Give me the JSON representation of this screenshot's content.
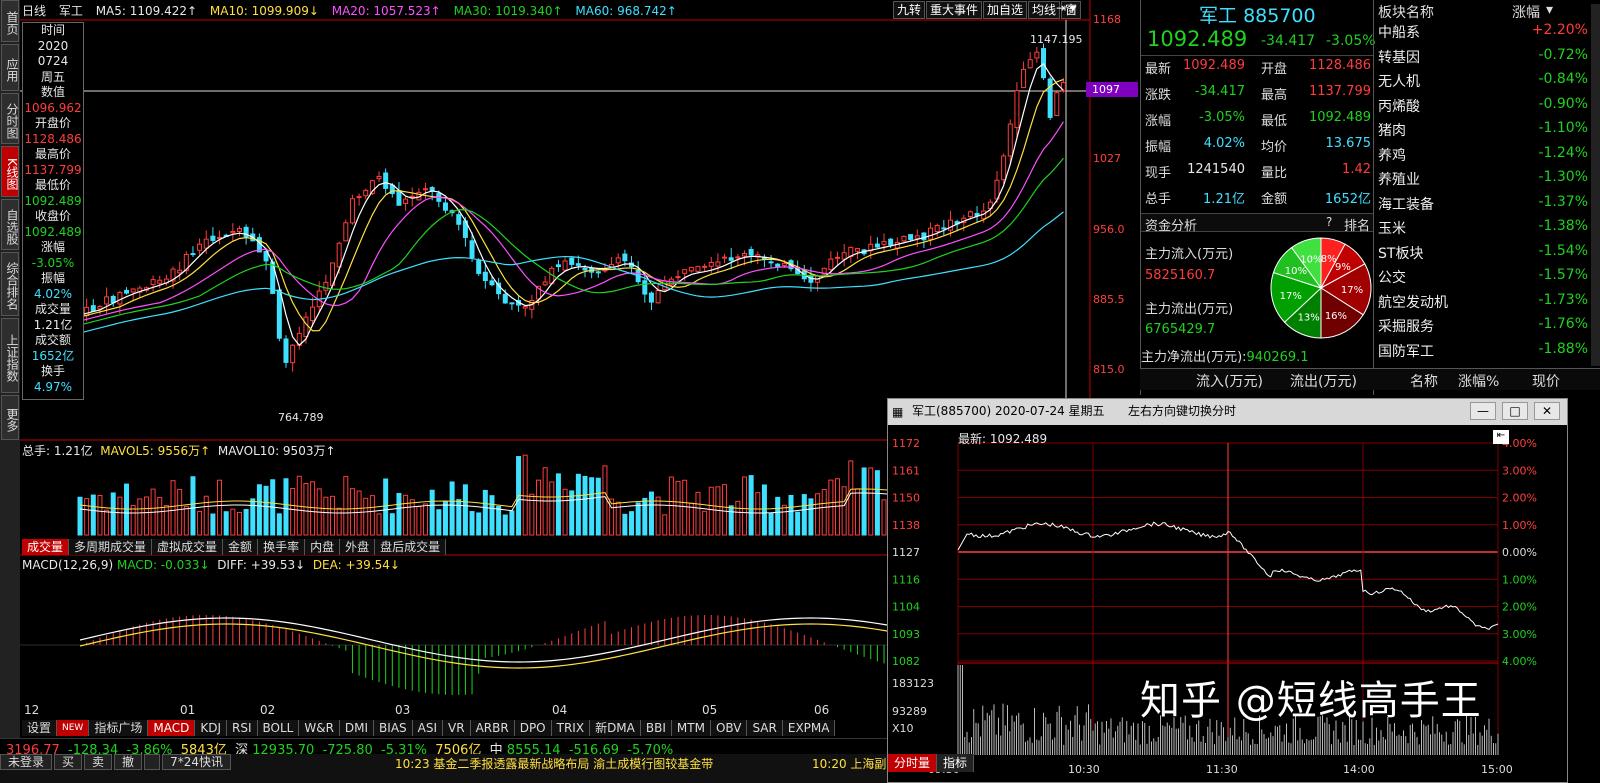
{
  "left_tabs": [
    "首页",
    "应用",
    "分时图",
    "K线图",
    "自选股",
    "综合排名",
    "上证指数",
    "更多"
  ],
  "kline_header": {
    "period": "日线",
    "name": "军工",
    "ma5": "MA5: 1109.422↑",
    "ma10": "MA10: 1099.909↓",
    "ma20": "MA20: 1057.523↑",
    "ma30": "MA30: 1019.340↑",
    "ma60": "MA60: 968.742↑"
  },
  "top_buttons": [
    "九转",
    "重大事件",
    "加自选",
    "均线",
    "窗"
  ],
  "info_box": [
    {
      "t": "时间",
      "c": "wht"
    },
    {
      "t": "2020",
      "c": "wht"
    },
    {
      "t": "0724",
      "c": "wht"
    },
    {
      "t": "周五",
      "c": "wht"
    },
    {
      "t": "数值",
      "c": "wht"
    },
    {
      "t": "1096.962",
      "c": "red"
    },
    {
      "t": "开盘价",
      "c": "wht"
    },
    {
      "t": "1128.486",
      "c": "red"
    },
    {
      "t": "最高价",
      "c": "wht"
    },
    {
      "t": "1137.799",
      "c": "red"
    },
    {
      "t": "最低价",
      "c": "wht"
    },
    {
      "t": "1092.489",
      "c": "grn"
    },
    {
      "t": "收盘价",
      "c": "wht"
    },
    {
      "t": "1092.489",
      "c": "grn"
    },
    {
      "t": "涨幅",
      "c": "wht"
    },
    {
      "t": "-3.05%",
      "c": "grn"
    },
    {
      "t": "振幅",
      "c": "wht"
    },
    {
      "t": "4.02%",
      "c": "cyan"
    },
    {
      "t": "成交量",
      "c": "wht"
    },
    {
      "t": "1.21亿",
      "c": "wht"
    },
    {
      "t": "成交额",
      "c": "wht"
    },
    {
      "t": "1652亿",
      "c": "cyan"
    },
    {
      "t": "换手",
      "c": "wht"
    },
    {
      "t": "4.97%",
      "c": "cyan"
    }
  ],
  "y_axis": [
    "1168",
    "1097",
    "1027",
    "956.0",
    "885.5",
    "815.0"
  ],
  "price_tag": "1097",
  "high_label": "1147.195",
  "low_label": "764.789",
  "vol_header": {
    "total": "总手: 1.21亿",
    "mavol5": "MAVOL5: 9556万↑",
    "mavol10": "MAVOL10: 9503万↑"
  },
  "vol_tabs": [
    "成交量",
    "多周期成交量",
    "虚拟成交量",
    "金额",
    "换手率",
    "内盘",
    "外盘",
    "盘后成交量"
  ],
  "macd_header": {
    "name": "MACD(12,26,9)",
    "macd": "MACD: -0.033↓",
    "diff": "DIFF: +39.53↓",
    "dea": "DEA: +39.54↓"
  },
  "months": [
    "12",
    "01",
    "02",
    "03",
    "04",
    "05",
    "06"
  ],
  "ind_tabs": [
    "设置",
    "NEW",
    "指标广场",
    "MACD",
    "KDJ",
    "RSI",
    "BOLL",
    "W&R",
    "DMI",
    "BIAS",
    "ASI",
    "VR",
    "ARBR",
    "DPO",
    "TRIX",
    "新DMA",
    "BBI",
    "MTM",
    "OBV",
    "SAR",
    "EXPMA"
  ],
  "index_row": {
    "sh_val": "3196.77",
    "sh_chg": "-128.34",
    "sh_pct": "-3.86%",
    "sh_amt": "5843亿",
    "sz_name": "深",
    "sz_val": "12935.70",
    "sz_chg": "-725.80",
    "sz_pct": "-5.31%",
    "sz_amt": "7506亿",
    "zx_name": "中",
    "zx_val": "8555.14",
    "zx_chg": "-516.69",
    "zx_pct": "-5.70%"
  },
  "bottom_buttons": [
    "未登录",
    "买",
    "卖",
    "撤",
    "",
    "7*24快讯"
  ],
  "news": "10:23 基金二季报透露最新战略布局 渝土成模行图较基金带",
  "news2": "10:20 上海副",
  "quote": {
    "name": "军工",
    "code": "885700",
    "price": "1092.489",
    "chg": "-34.417",
    "pct": "-3.05%",
    "rows": [
      [
        "最新",
        "1092.489",
        "red",
        "开盘",
        "1128.486",
        "red"
      ],
      [
        "涨跌",
        "-34.417",
        "grn",
        "最高",
        "1137.799",
        "red"
      ],
      [
        "涨幅",
        "-3.05%",
        "grn",
        "最低",
        "1092.489",
        "grn"
      ],
      [
        "振幅",
        "4.02%",
        "cyan",
        "均价",
        "13.675",
        "cyan"
      ],
      [
        "现手",
        "1241540",
        "wht",
        "量比",
        "1.42",
        "red"
      ],
      [
        "总手",
        "1.21亿",
        "cyan",
        "金额",
        "1652亿",
        "cyan"
      ]
    ]
  },
  "fund": {
    "title": "资金分析",
    "help": "?",
    "rank": "排名",
    "in_label": "主力流入(万元)",
    "in_val": "5825160.7",
    "out_label": "主力流出(万元)",
    "out_val": "6765429.7",
    "net_label": "主力净流出(万元):",
    "net_val": "940269.1",
    "pie": [
      {
        "v": 8,
        "c": "#ff2020"
      },
      {
        "v": 9,
        "c": "#c00000"
      },
      {
        "v": 17,
        "c": "#a00000"
      },
      {
        "v": 16,
        "c": "#700000"
      },
      {
        "v": 13,
        "c": "#008000"
      },
      {
        "v": 17,
        "c": "#00a000"
      },
      {
        "v": 10,
        "c": "#20c020"
      },
      {
        "v": 10,
        "c": "#40e040"
      }
    ]
  },
  "sector": {
    "h1": "板块名称",
    "h2": "涨幅",
    "rows": [
      [
        "中船系",
        "+2.20%",
        "red"
      ],
      [
        "转基因",
        "-0.72%",
        "grn"
      ],
      [
        "无人机",
        "-0.84%",
        "grn"
      ],
      [
        "丙烯酸",
        "-0.90%",
        "grn"
      ],
      [
        "猪肉",
        "-1.10%",
        "grn"
      ],
      [
        "养鸡",
        "-1.24%",
        "grn"
      ],
      [
        "养殖业",
        "-1.30%",
        "grn"
      ],
      [
        "海工装备",
        "-1.37%",
        "grn"
      ],
      [
        "玉米",
        "-1.38%",
        "grn"
      ],
      [
        "ST板块",
        "-1.54%",
        "grn"
      ],
      [
        "公交",
        "-1.57%",
        "grn"
      ],
      [
        "航空发动机",
        "-1.73%",
        "grn"
      ],
      [
        "采掘服务",
        "-1.76%",
        "grn"
      ],
      [
        "国防军工",
        "-1.88%",
        "grn"
      ]
    ]
  },
  "flow_head": [
    "流入(万元)",
    "流出(万元)",
    "名称",
    "涨幅%",
    "现价"
  ],
  "popup": {
    "title": "军工(885700) 2020-07-24 星期五",
    "hint": "左右方向键切换分时",
    "latest": "最新: 1092.489",
    "y_left": [
      "1172",
      "1161",
      "1150",
      "1138",
      "1127",
      "1116",
      "1104",
      "1093",
      "1082"
    ],
    "y_right": [
      "4.00%",
      "3.00%",
      "2.00%",
      "1.00%",
      "0.00%",
      "1.00%",
      "2.00%",
      "3.00%",
      "4.00%"
    ],
    "vol_left": [
      "183123",
      "93289",
      "X10"
    ],
    "times": [
      "09:30",
      "10:30",
      "11:30",
      "14:00",
      "15:00"
    ],
    "tabs": [
      "分时量",
      "指标"
    ]
  },
  "watermark": "知乎 @短线高手王"
}
